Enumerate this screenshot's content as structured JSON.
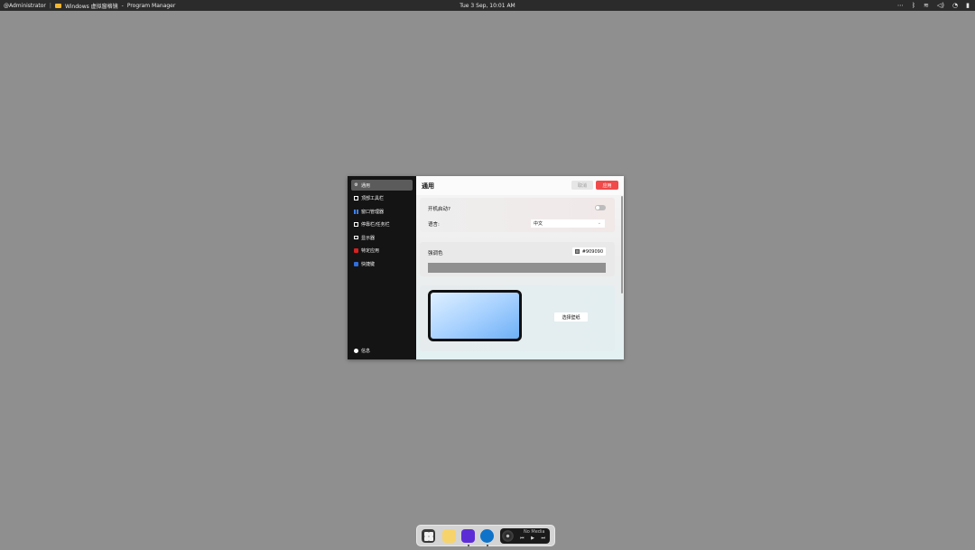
{
  "topbar": {
    "user": "@Administrator",
    "app_title": "Windows 虚拟窗格镜",
    "separator": "-",
    "program": "Program Manager",
    "clock": "Tue 3 Sep, 10:01 AM",
    "tray_icons": [
      "more-icon",
      "bluetooth-icon",
      "wifi-icon",
      "volume-icon",
      "notification-icon",
      "battery-icon"
    ]
  },
  "sidebar": {
    "items": [
      {
        "label": "通用",
        "icon": "gear-icon",
        "active": true
      },
      {
        "label": "顶部工具栏",
        "icon": "window-icon",
        "active": false
      },
      {
        "label": "窗口管理器",
        "icon": "windows-grid-icon",
        "active": false
      },
      {
        "label": "停靠栏/任务栏",
        "icon": "dock-icon",
        "active": false
      },
      {
        "label": "显示器",
        "icon": "monitor-icon",
        "active": false
      },
      {
        "label": "特定应用",
        "icon": "app-icon",
        "active": false
      },
      {
        "label": "快捷键",
        "icon": "keyboard-icon",
        "active": false
      }
    ],
    "about": "信息"
  },
  "content": {
    "title": "通用",
    "cancel_label": "取消",
    "save_label": "应用",
    "startup_label": "开机启动?",
    "startup_enabled": false,
    "language_label": "语言:",
    "language_value": "中文",
    "accent_label": "强调色",
    "accent_value": "#909090",
    "accent_color": "#909090",
    "wallpaper_button": "选择壁纸"
  },
  "dock": {
    "items": [
      "launcher-icon",
      "file-explorer-icon",
      "store-icon",
      "edge-icon"
    ],
    "media_title": "No Media"
  }
}
